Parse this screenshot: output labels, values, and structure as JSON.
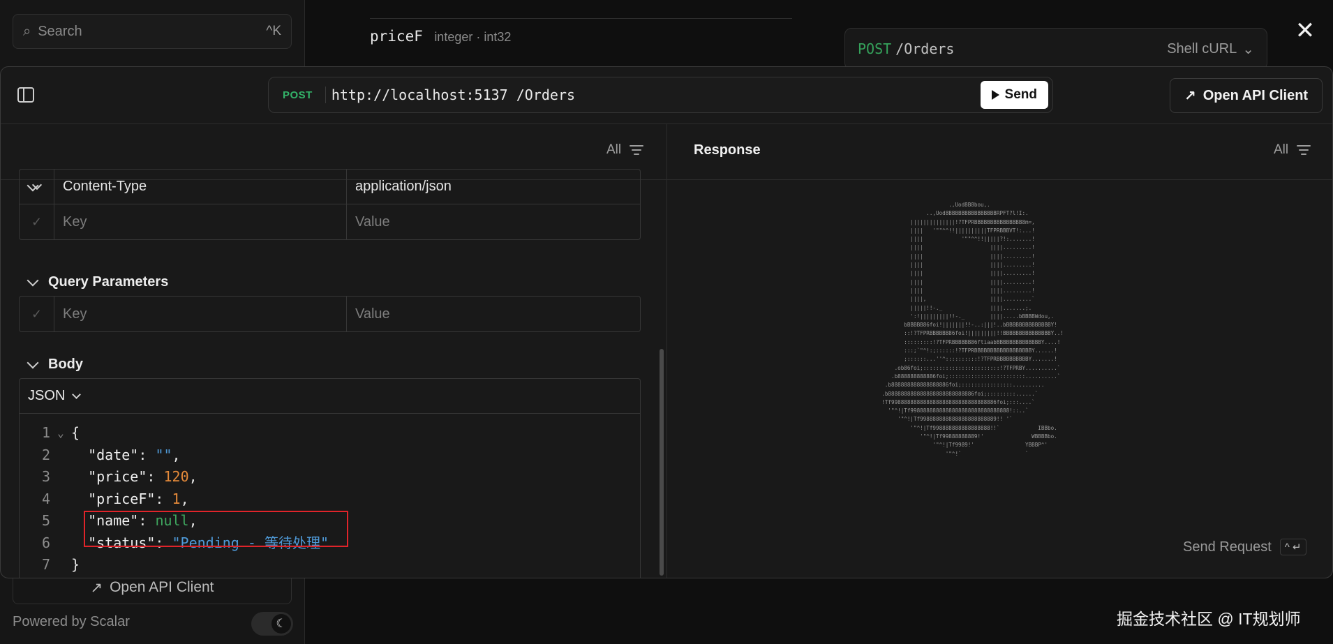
{
  "background": {
    "search": {
      "placeholder": "Search",
      "shortcut": "^K"
    },
    "field": {
      "name": "priceF",
      "type": "integer · int32"
    },
    "code_sample": {
      "method": "POST",
      "path": "/Orders",
      "language": "Shell cURL"
    },
    "sidebar_footer": {
      "open_api_label": "Open API Client",
      "powered_by": "Powered by Scalar"
    }
  },
  "modal": {
    "request": {
      "method": "POST",
      "url": "http://localhost:5137 /Orders",
      "send_label": "Send"
    },
    "open_api_client_label": "Open API Client",
    "left": {
      "filter_label": "All",
      "headers_rows": [
        {
          "key": "Content-Type",
          "value": "application/json",
          "filled": true
        },
        {
          "key": "Key",
          "value": "Value",
          "filled": false
        }
      ],
      "query_title": "Query Parameters",
      "query_rows": [
        {
          "key": "Key",
          "value": "Value"
        }
      ],
      "body_title": "Body",
      "body_format": "JSON",
      "code_lines": [
        {
          "n": "1",
          "text": "{"
        },
        {
          "n": "2",
          "key": "\"date\"",
          "value": "\"\"",
          "vtype": "s",
          "comma": true
        },
        {
          "n": "3",
          "key": "\"price\"",
          "value": "120",
          "vtype": "n",
          "comma": true
        },
        {
          "n": "4",
          "key": "\"priceF\"",
          "value": "1",
          "vtype": "n",
          "comma": true
        },
        {
          "n": "5",
          "key": "\"name\"",
          "value": "null",
          "vtype": "nl",
          "comma": true
        },
        {
          "n": "6",
          "key": "\"status\"",
          "value": "\"Pending - 等待处理\"",
          "vtype": "s",
          "comma": false
        },
        {
          "n": "7",
          "text": "}"
        }
      ]
    },
    "right": {
      "title": "Response",
      "filter_label": "All",
      "send_request_label": "Send Request",
      "send_request_shortcut": "^ ↵"
    }
  },
  "watermark": "掘金技术社区 @ IT规划师",
  "colors": {
    "method_green": "#33b369",
    "string_blue": "#4f9ad8",
    "number_orange": "#e58a3a",
    "highlight_red": "#e0242a"
  }
}
